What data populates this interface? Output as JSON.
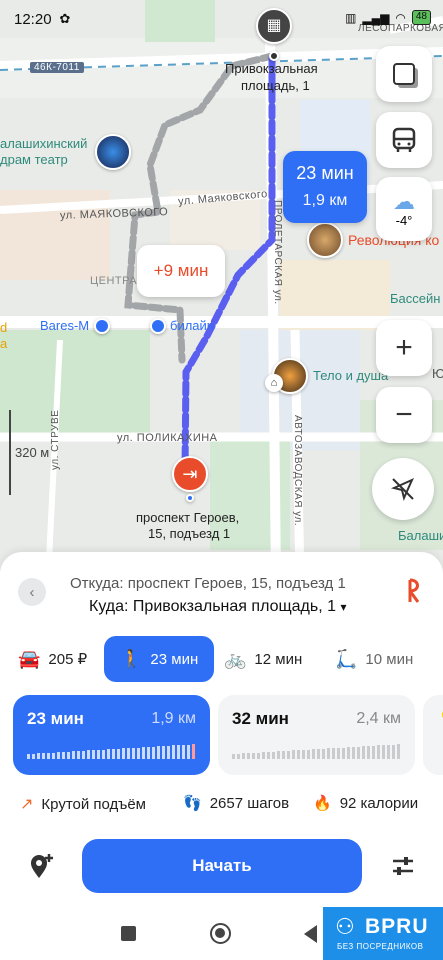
{
  "status": {
    "time": "12:20",
    "battery": "48"
  },
  "map": {
    "labels": {
      "road_46k": "46К-7011",
      "station": "ЛЕСОПАРКОВАЯ",
      "destination_l1": "Привокзальная",
      "destination_l2": "площадь, 1",
      "theatre_l1": "алашихинский",
      "theatre_l2": "драм театр",
      "mayakovskogo_1": "ул. МАЯКОВСКОГО",
      "mayakovskogo_2": "ул. Маяковского",
      "center": "ЦЕНТРА",
      "proletarskaya": "ПРОЛЕТАРСКАЯ ул.",
      "revolution": "Революция ко",
      "pool": "Бассейн",
      "bares": "Bares-M",
      "beeline": "билайн",
      "body_soul": "Тело и душа",
      "left_d": "d",
      "left_a": "a",
      "polikakhina": "ул. ПОЛИКАХИНА",
      "scale": "320 м",
      "struve": "ул. СТРУВЕ",
      "avtozavodskaya": "АВТОЗАВОДСКАЯ ул.",
      "right_yu": "Ю",
      "balashikha": "Балашихин",
      "start_l1": "проспект Героев,",
      "start_l2": "15, подъезд 1"
    },
    "bubble_time": "23 мин",
    "bubble_distance": "1,9 км",
    "alt_bubble": "+9 мин",
    "weather_temp": "-4°"
  },
  "route": {
    "from": "Откуда: проспект Героев, 15, подъезд 1",
    "to": "Куда: Привокзальная площадь, 1",
    "to_caret": "▾"
  },
  "tabs": [
    {
      "label": "205 ₽",
      "icon": "car-icon"
    },
    {
      "label": "23 мин",
      "icon": "walk-icon"
    },
    {
      "label": "12 мин",
      "icon": "bike-icon"
    },
    {
      "label": "10 мин",
      "icon": "scooter-icon"
    }
  ],
  "cards": [
    {
      "time": "23 мин",
      "distance": "1,9 км"
    },
    {
      "time": "32 мин",
      "distance": "2,4 км"
    }
  ],
  "info": {
    "climb": "Крутой подъём",
    "steps": "2657 шагов",
    "calories": "92 калории"
  },
  "start_button": "Начать",
  "watermark": {
    "brand": "BPRU",
    "tagline": "БЕЗ ПОСРЕДНИКОВ"
  },
  "colors": {
    "accent": "#2f6ff5",
    "alt_route": "#e84c2b",
    "brand": "#1e8fe8"
  }
}
